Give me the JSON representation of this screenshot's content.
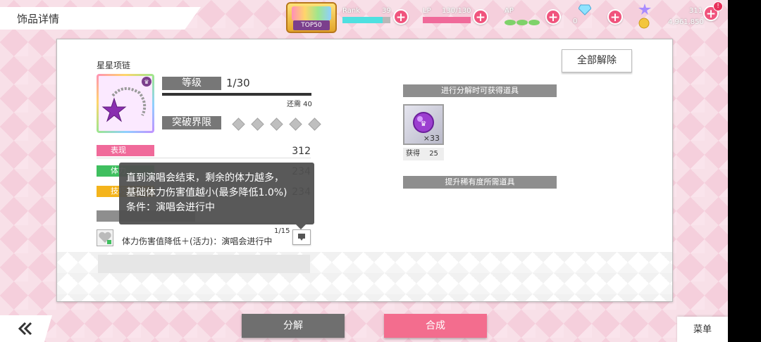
{
  "header": {
    "title": "饰品详情",
    "badge_text": "TOP50",
    "rank_label": "Rank",
    "rank_value": "39",
    "lp_label": "LP",
    "lp_value": "130/130",
    "ap_label": "AP",
    "gems_value": "0",
    "stars_value": "311",
    "coins_value": "4,961,850"
  },
  "panel": {
    "item_name": "星星项链",
    "level_label": "等级",
    "level_value": "1/30",
    "exp_needed": "还需 40",
    "limit_break_label": "突破界限",
    "stats": [
      {
        "label": "表现",
        "value": "312",
        "color": "#f06a9a"
      },
      {
        "label": "体力",
        "value": "234",
        "color": "#3fbf5f"
      },
      {
        "label": "技巧",
        "value": "234",
        "color": "#f4b41c"
      }
    ],
    "skill_text": "体力伤害值降低＋(活力)：演唱会进行中",
    "skill_level": "1/15",
    "release_all_button": "全部解除",
    "disassemble_section": "进行分解时可获得道具",
    "reward_count": "×33",
    "reward_obtain_label": "获得",
    "reward_obtain_value": "25",
    "rarity_section": "提升稀有度所需道具"
  },
  "tooltip": {
    "line1": "直到演唱会结束，剩余的体力越多，",
    "line2": "基础体力伤害值越小(最多降低1.0%)",
    "line3": "条件：演唱会进行中"
  },
  "footer": {
    "disassemble_button": "分解",
    "synthesize_button": "合成",
    "menu_button": "菜单"
  },
  "colors": {
    "accent_pink": "#f0547d",
    "rank_bar": "#4fe0e0",
    "lp_bar": "#f06a9a"
  }
}
